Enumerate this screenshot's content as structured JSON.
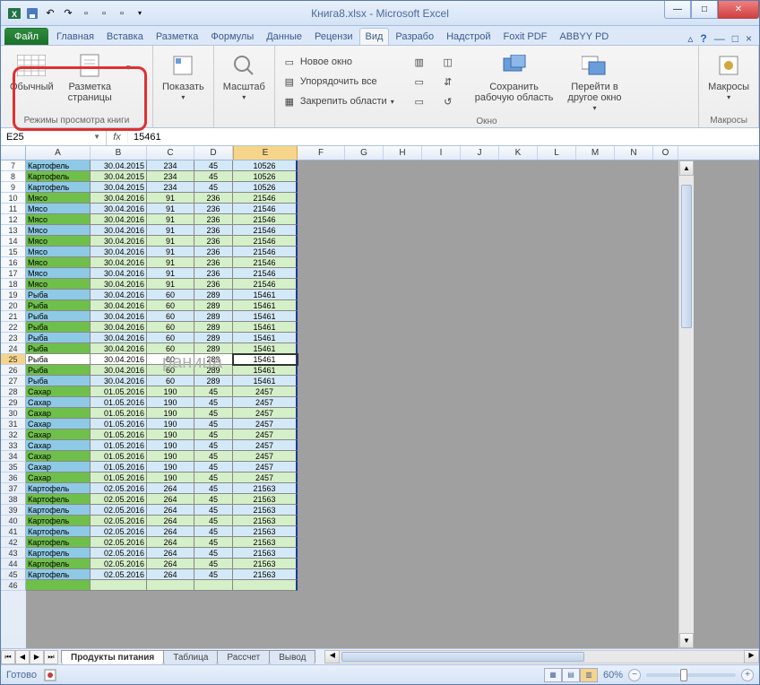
{
  "window": {
    "title": "Книга8.xlsx - Microsoft Excel"
  },
  "qat": [
    "excel",
    "save",
    "undo",
    "redo",
    "misc1",
    "misc2",
    "misc3",
    "misc4"
  ],
  "tabs": {
    "file": "Файл",
    "items": [
      "Главная",
      "Вставка",
      "Разметка",
      "Формулы",
      "Данные",
      "Рецензи",
      "Вид",
      "Разрабо",
      "Надстрой",
      "Foxit PDF",
      "ABBYY PD"
    ],
    "active_index": 6
  },
  "ribbon": {
    "group_views": {
      "label": "Режимы просмотра книги",
      "normal": "Обычный",
      "page_layout": "Разметка\nстраницы"
    },
    "group_show": {
      "btn": "Показать"
    },
    "group_zoom": {
      "btn": "Масштаб"
    },
    "group_window": {
      "label": "Окно",
      "new_window": "Новое окно",
      "arrange": "Упорядочить все",
      "freeze": "Закрепить области",
      "save_workspace": "Сохранить\nрабочую область",
      "switch_window": "Перейти в\nдругое окно"
    },
    "group_macros": {
      "label": "Макросы",
      "btn": "Макросы"
    }
  },
  "namebox": {
    "value": "E25"
  },
  "formula": {
    "value": "15461"
  },
  "columns": {
    "A": 72,
    "B": 63,
    "C": 53,
    "D": 43,
    "E": 72,
    "F": 53,
    "G": 43,
    "H": 43,
    "I": 43,
    "J": 43,
    "K": 43,
    "L": 43,
    "M": 43,
    "N": 43,
    "O": 28
  },
  "col_order": [
    "A",
    "B",
    "C",
    "D",
    "E",
    "F",
    "G",
    "H",
    "I",
    "J",
    "K",
    "L",
    "M",
    "N",
    "O"
  ],
  "active_row": 25,
  "active_col": "E",
  "watermark": "раница",
  "rows": [
    {
      "n": 7,
      "c": "blue",
      "a": "Картофель",
      "b": "30.04.2015",
      "cc": "234",
      "d": "45",
      "e": "10526"
    },
    {
      "n": 8,
      "c": "green",
      "a": "Картофель",
      "b": "30.04.2015",
      "cc": "234",
      "d": "45",
      "e": "10526"
    },
    {
      "n": 9,
      "c": "blue",
      "a": "Картофель",
      "b": "30.04.2015",
      "cc": "234",
      "d": "45",
      "e": "10526"
    },
    {
      "n": 10,
      "c": "green",
      "a": "Мясо",
      "b": "30.04.2016",
      "cc": "91",
      "d": "236",
      "e": "21546"
    },
    {
      "n": 11,
      "c": "blue",
      "a": "Мясо",
      "b": "30.04.2016",
      "cc": "91",
      "d": "236",
      "e": "21546"
    },
    {
      "n": 12,
      "c": "green",
      "a": "Мясо",
      "b": "30.04.2016",
      "cc": "91",
      "d": "236",
      "e": "21546"
    },
    {
      "n": 13,
      "c": "blue",
      "a": "Мясо",
      "b": "30.04.2016",
      "cc": "91",
      "d": "236",
      "e": "21546"
    },
    {
      "n": 14,
      "c": "green",
      "a": "Мясо",
      "b": "30.04.2016",
      "cc": "91",
      "d": "236",
      "e": "21546"
    },
    {
      "n": 15,
      "c": "blue",
      "a": "Мясо",
      "b": "30.04.2016",
      "cc": "91",
      "d": "236",
      "e": "21546"
    },
    {
      "n": 16,
      "c": "green",
      "a": "Мясо",
      "b": "30.04.2016",
      "cc": "91",
      "d": "236",
      "e": "21546"
    },
    {
      "n": 17,
      "c": "blue",
      "a": "Мясо",
      "b": "30.04.2016",
      "cc": "91",
      "d": "236",
      "e": "21546"
    },
    {
      "n": 18,
      "c": "green",
      "a": "Мясо",
      "b": "30.04.2016",
      "cc": "91",
      "d": "236",
      "e": "21546"
    },
    {
      "n": 19,
      "c": "blue",
      "a": "Рыба",
      "b": "30.04.2016",
      "cc": "60",
      "d": "289",
      "e": "15461"
    },
    {
      "n": 20,
      "c": "green",
      "a": "Рыба",
      "b": "30.04.2016",
      "cc": "60",
      "d": "289",
      "e": "15461"
    },
    {
      "n": 21,
      "c": "blue",
      "a": "Рыба",
      "b": "30.04.2016",
      "cc": "60",
      "d": "289",
      "e": "15461"
    },
    {
      "n": 22,
      "c": "green",
      "a": "Рыба",
      "b": "30.04.2016",
      "cc": "60",
      "d": "289",
      "e": "15461"
    },
    {
      "n": 23,
      "c": "blue",
      "a": "Рыба",
      "b": "30.04.2016",
      "cc": "60",
      "d": "289",
      "e": "15461"
    },
    {
      "n": 24,
      "c": "green",
      "a": "Рыба",
      "b": "30.04.2016",
      "cc": "60",
      "d": "289",
      "e": "15461"
    },
    {
      "n": 25,
      "c": "blue",
      "a": "Рыба",
      "b": "30.04.2016",
      "cc": "60",
      "d": "289",
      "e": "15461"
    },
    {
      "n": 26,
      "c": "green",
      "a": "Рыба",
      "b": "30.04.2016",
      "cc": "60",
      "d": "289",
      "e": "15461"
    },
    {
      "n": 27,
      "c": "blue",
      "a": "Рыба",
      "b": "30.04.2016",
      "cc": "60",
      "d": "289",
      "e": "15461"
    },
    {
      "n": 28,
      "c": "green",
      "a": "Сахар",
      "b": "01.05.2016",
      "cc": "190",
      "d": "45",
      "e": "2457"
    },
    {
      "n": 29,
      "c": "blue",
      "a": "Сахар",
      "b": "01.05.2016",
      "cc": "190",
      "d": "45",
      "e": "2457"
    },
    {
      "n": 30,
      "c": "green",
      "a": "Сахар",
      "b": "01.05.2016",
      "cc": "190",
      "d": "45",
      "e": "2457"
    },
    {
      "n": 31,
      "c": "blue",
      "a": "Сахар",
      "b": "01.05.2016",
      "cc": "190",
      "d": "45",
      "e": "2457"
    },
    {
      "n": 32,
      "c": "green",
      "a": "Сахар",
      "b": "01.05.2016",
      "cc": "190",
      "d": "45",
      "e": "2457"
    },
    {
      "n": 33,
      "c": "blue",
      "a": "Сахар",
      "b": "01.05.2016",
      "cc": "190",
      "d": "45",
      "e": "2457"
    },
    {
      "n": 34,
      "c": "green",
      "a": "Сахар",
      "b": "01.05.2016",
      "cc": "190",
      "d": "45",
      "e": "2457"
    },
    {
      "n": 35,
      "c": "blue",
      "a": "Сахар",
      "b": "01.05.2016",
      "cc": "190",
      "d": "45",
      "e": "2457"
    },
    {
      "n": 36,
      "c": "green",
      "a": "Сахар",
      "b": "01.05.2016",
      "cc": "190",
      "d": "45",
      "e": "2457"
    },
    {
      "n": 37,
      "c": "blue",
      "a": "Картофель",
      "b": "02.05.2016",
      "cc": "264",
      "d": "45",
      "e": "21563"
    },
    {
      "n": 38,
      "c": "green",
      "a": "Картофель",
      "b": "02.05.2016",
      "cc": "264",
      "d": "45",
      "e": "21563"
    },
    {
      "n": 39,
      "c": "blue",
      "a": "Картофель",
      "b": "02.05.2016",
      "cc": "264",
      "d": "45",
      "e": "21563"
    },
    {
      "n": 40,
      "c": "green",
      "a": "Картофель",
      "b": "02.05.2016",
      "cc": "264",
      "d": "45",
      "e": "21563"
    },
    {
      "n": 41,
      "c": "blue",
      "a": "Картофель",
      "b": "02.05.2016",
      "cc": "264",
      "d": "45",
      "e": "21563"
    },
    {
      "n": 42,
      "c": "green",
      "a": "Картофель",
      "b": "02.05.2016",
      "cc": "264",
      "d": "45",
      "e": "21563"
    },
    {
      "n": 43,
      "c": "blue",
      "a": "Картофель",
      "b": "02.05.2016",
      "cc": "264",
      "d": "45",
      "e": "21563"
    },
    {
      "n": 44,
      "c": "green",
      "a": "Картофель",
      "b": "02.05.2016",
      "cc": "264",
      "d": "45",
      "e": "21563"
    },
    {
      "n": 45,
      "c": "blue",
      "a": "Картофель",
      "b": "02.05.2016",
      "cc": "264",
      "d": "45",
      "e": "21563"
    },
    {
      "n": 46,
      "c": "green",
      "a": "",
      "b": "",
      "cc": "",
      "d": "",
      "e": ""
    }
  ],
  "sheets": {
    "tabs": [
      "Продукты питания",
      "Таблица",
      "Рассчет",
      "Вывод"
    ],
    "active": 0
  },
  "status": {
    "ready": "Готово",
    "zoom": "60%"
  }
}
